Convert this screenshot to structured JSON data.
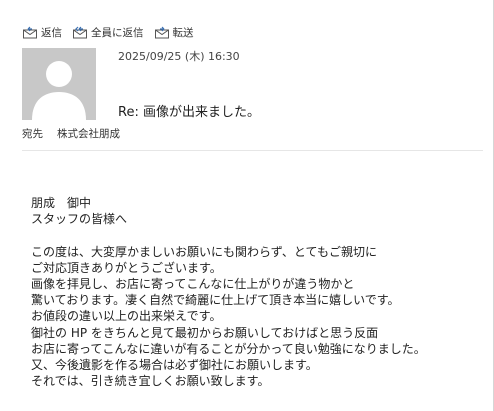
{
  "toolbar": {
    "reply_label": "返信",
    "reply_all_label": "全員に返信",
    "forward_label": "転送"
  },
  "header": {
    "date": "2025/09/25 (木) 16:30",
    "subject": "Re: 画像が出来ました。",
    "to_label": "宛先",
    "to_value": "株式会社朋成"
  },
  "body": {
    "greeting": [
      "朋成　御中",
      "スタッフの皆様へ"
    ],
    "paragraph": [
      "この度は、大変厚かましいお願いにも関わらず、とてもご親切に",
      "ご対応頂きありがとうございます。",
      "画像を拝見し、お店に寄ってこんなに仕上がりが違う物かと",
      "驚いております。凄く自然で綺麗に仕上げて頂き本当に嬉しいです。",
      "お値段の違い以上の出来栄えです。",
      "御社の HP をきちんと見て最初からお願いしておけばと思う反面",
      "お店に寄ってこんなに違いが有ることが分かって良い勉強になりました。",
      "又、今後遺影を作る場合は必ず御社にお願いします。",
      "それでは、引き続き宜しくお願い致します。"
    ]
  },
  "icons": {
    "reply": "reply-icon",
    "reply_all": "reply-all-icon",
    "forward": "forward-icon",
    "avatar": "person-placeholder-icon"
  }
}
